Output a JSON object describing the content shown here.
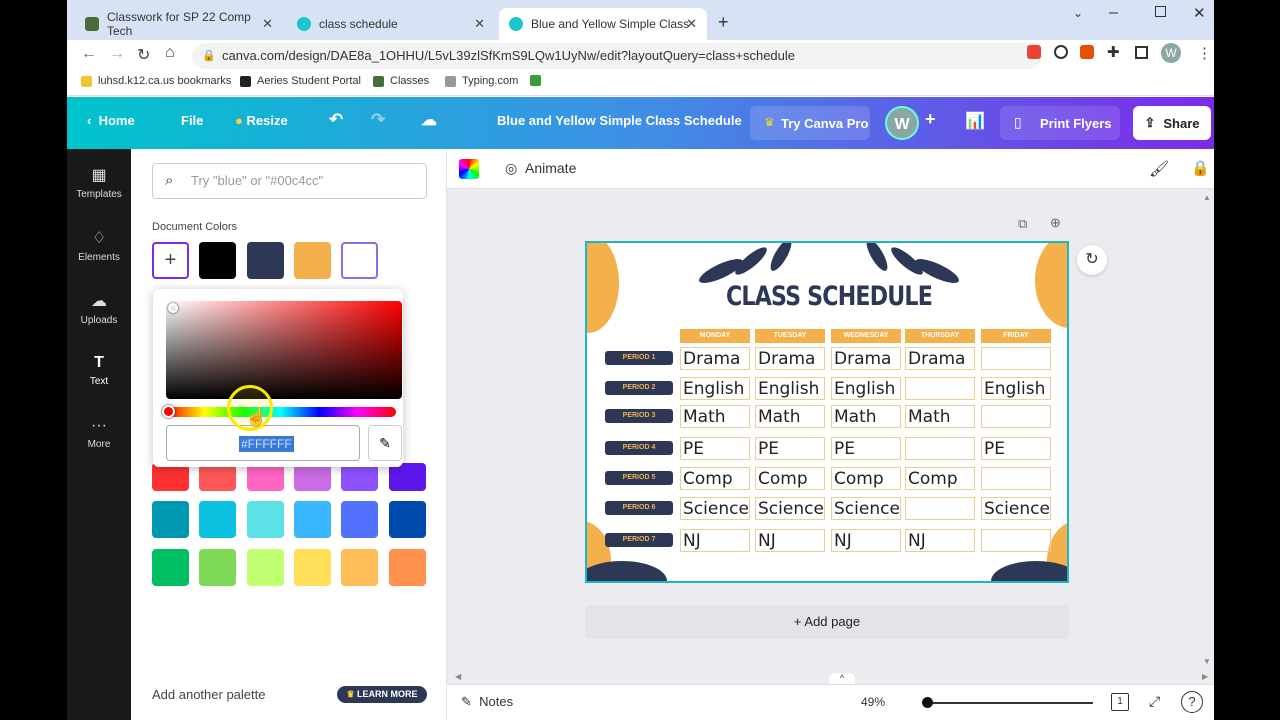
{
  "tabs": [
    {
      "label": "Classwork for SP 22 Comp Tech",
      "active": false
    },
    {
      "label": "class schedule",
      "active": false
    },
    {
      "label": "Blue and Yellow Simple Class Sch",
      "active": true
    }
  ],
  "url": "canva.com/design/DAE8a_1OHHU/L5vL39zlSfKmS9LQw1UyNw/edit?layoutQuery=class+schedule",
  "profile_initial": "W",
  "bookmarks": [
    "luhsd.k12.ca.us bookmarks",
    "Aeries Student Portal",
    "Classes",
    "Typing.com"
  ],
  "header": {
    "home": "Home",
    "file": "File",
    "resize": "Resize",
    "doc_title": "Blue and Yellow Simple Class Schedule",
    "try_pro": "Try Canva Pro",
    "avatar": "W",
    "print": "Print Flyers",
    "share": "Share"
  },
  "sidebar": [
    {
      "label": "Templates"
    },
    {
      "label": "Elements"
    },
    {
      "label": "Uploads"
    },
    {
      "label": "Text"
    },
    {
      "label": "More"
    }
  ],
  "panel": {
    "search_placeholder": "Try \"blue\" or \"#00c4cc\"",
    "doc_colors_title": "Document Colors",
    "doc_colors": [
      "#000000",
      "#2d3856",
      "#f3b04b",
      "#ffffff"
    ],
    "hex_value": "#FFFFFF",
    "palette_rows": [
      [
        "#ff3131",
        "#ff5757",
        "#ff66c4",
        "#cb6ce6",
        "#8c52ff",
        "#5e17eb"
      ],
      [
        "#0097b2",
        "#0cc0df",
        "#5ce1e6",
        "#38b6ff",
        "#5271ff",
        "#004aad"
      ],
      [
        "#00bf63",
        "#7ed957",
        "#c1ff72",
        "#ffde59",
        "#ffbd59",
        "#ff914d"
      ]
    ],
    "add_palette": "Add another palette",
    "learn_more": "LEARN MORE"
  },
  "toolbar": {
    "animate": "Animate"
  },
  "schedule": {
    "title": "CLASS SCHEDULE",
    "days": [
      "MONDAY",
      "TUESDAY",
      "WEDNESDAY",
      "THURSDAY",
      "FRIDAY"
    ],
    "periods": [
      "PERIOD 1",
      "PERIOD 2",
      "PERIOD 3",
      "PERIOD 4",
      "PERIOD 5",
      "PERIOD 6",
      "PERIOD 7"
    ],
    "cells": [
      [
        "Drama",
        "Drama",
        "Drama",
        "Drama",
        ""
      ],
      [
        "English",
        "English",
        "English",
        "",
        "English"
      ],
      [
        "Math",
        "Math",
        "Math",
        "Math",
        ""
      ],
      [
        "PE",
        "PE",
        "PE",
        "",
        "PE"
      ],
      [
        "Comp",
        "Comp",
        "Comp",
        "Comp",
        ""
      ],
      [
        "Science",
        "Science",
        "Science",
        "",
        "Science"
      ],
      [
        "NJ",
        "NJ",
        "NJ",
        "NJ",
        ""
      ]
    ]
  },
  "add_page": "+ Add page",
  "bottom": {
    "notes": "Notes",
    "zoom": "49%",
    "page_num": "1"
  }
}
